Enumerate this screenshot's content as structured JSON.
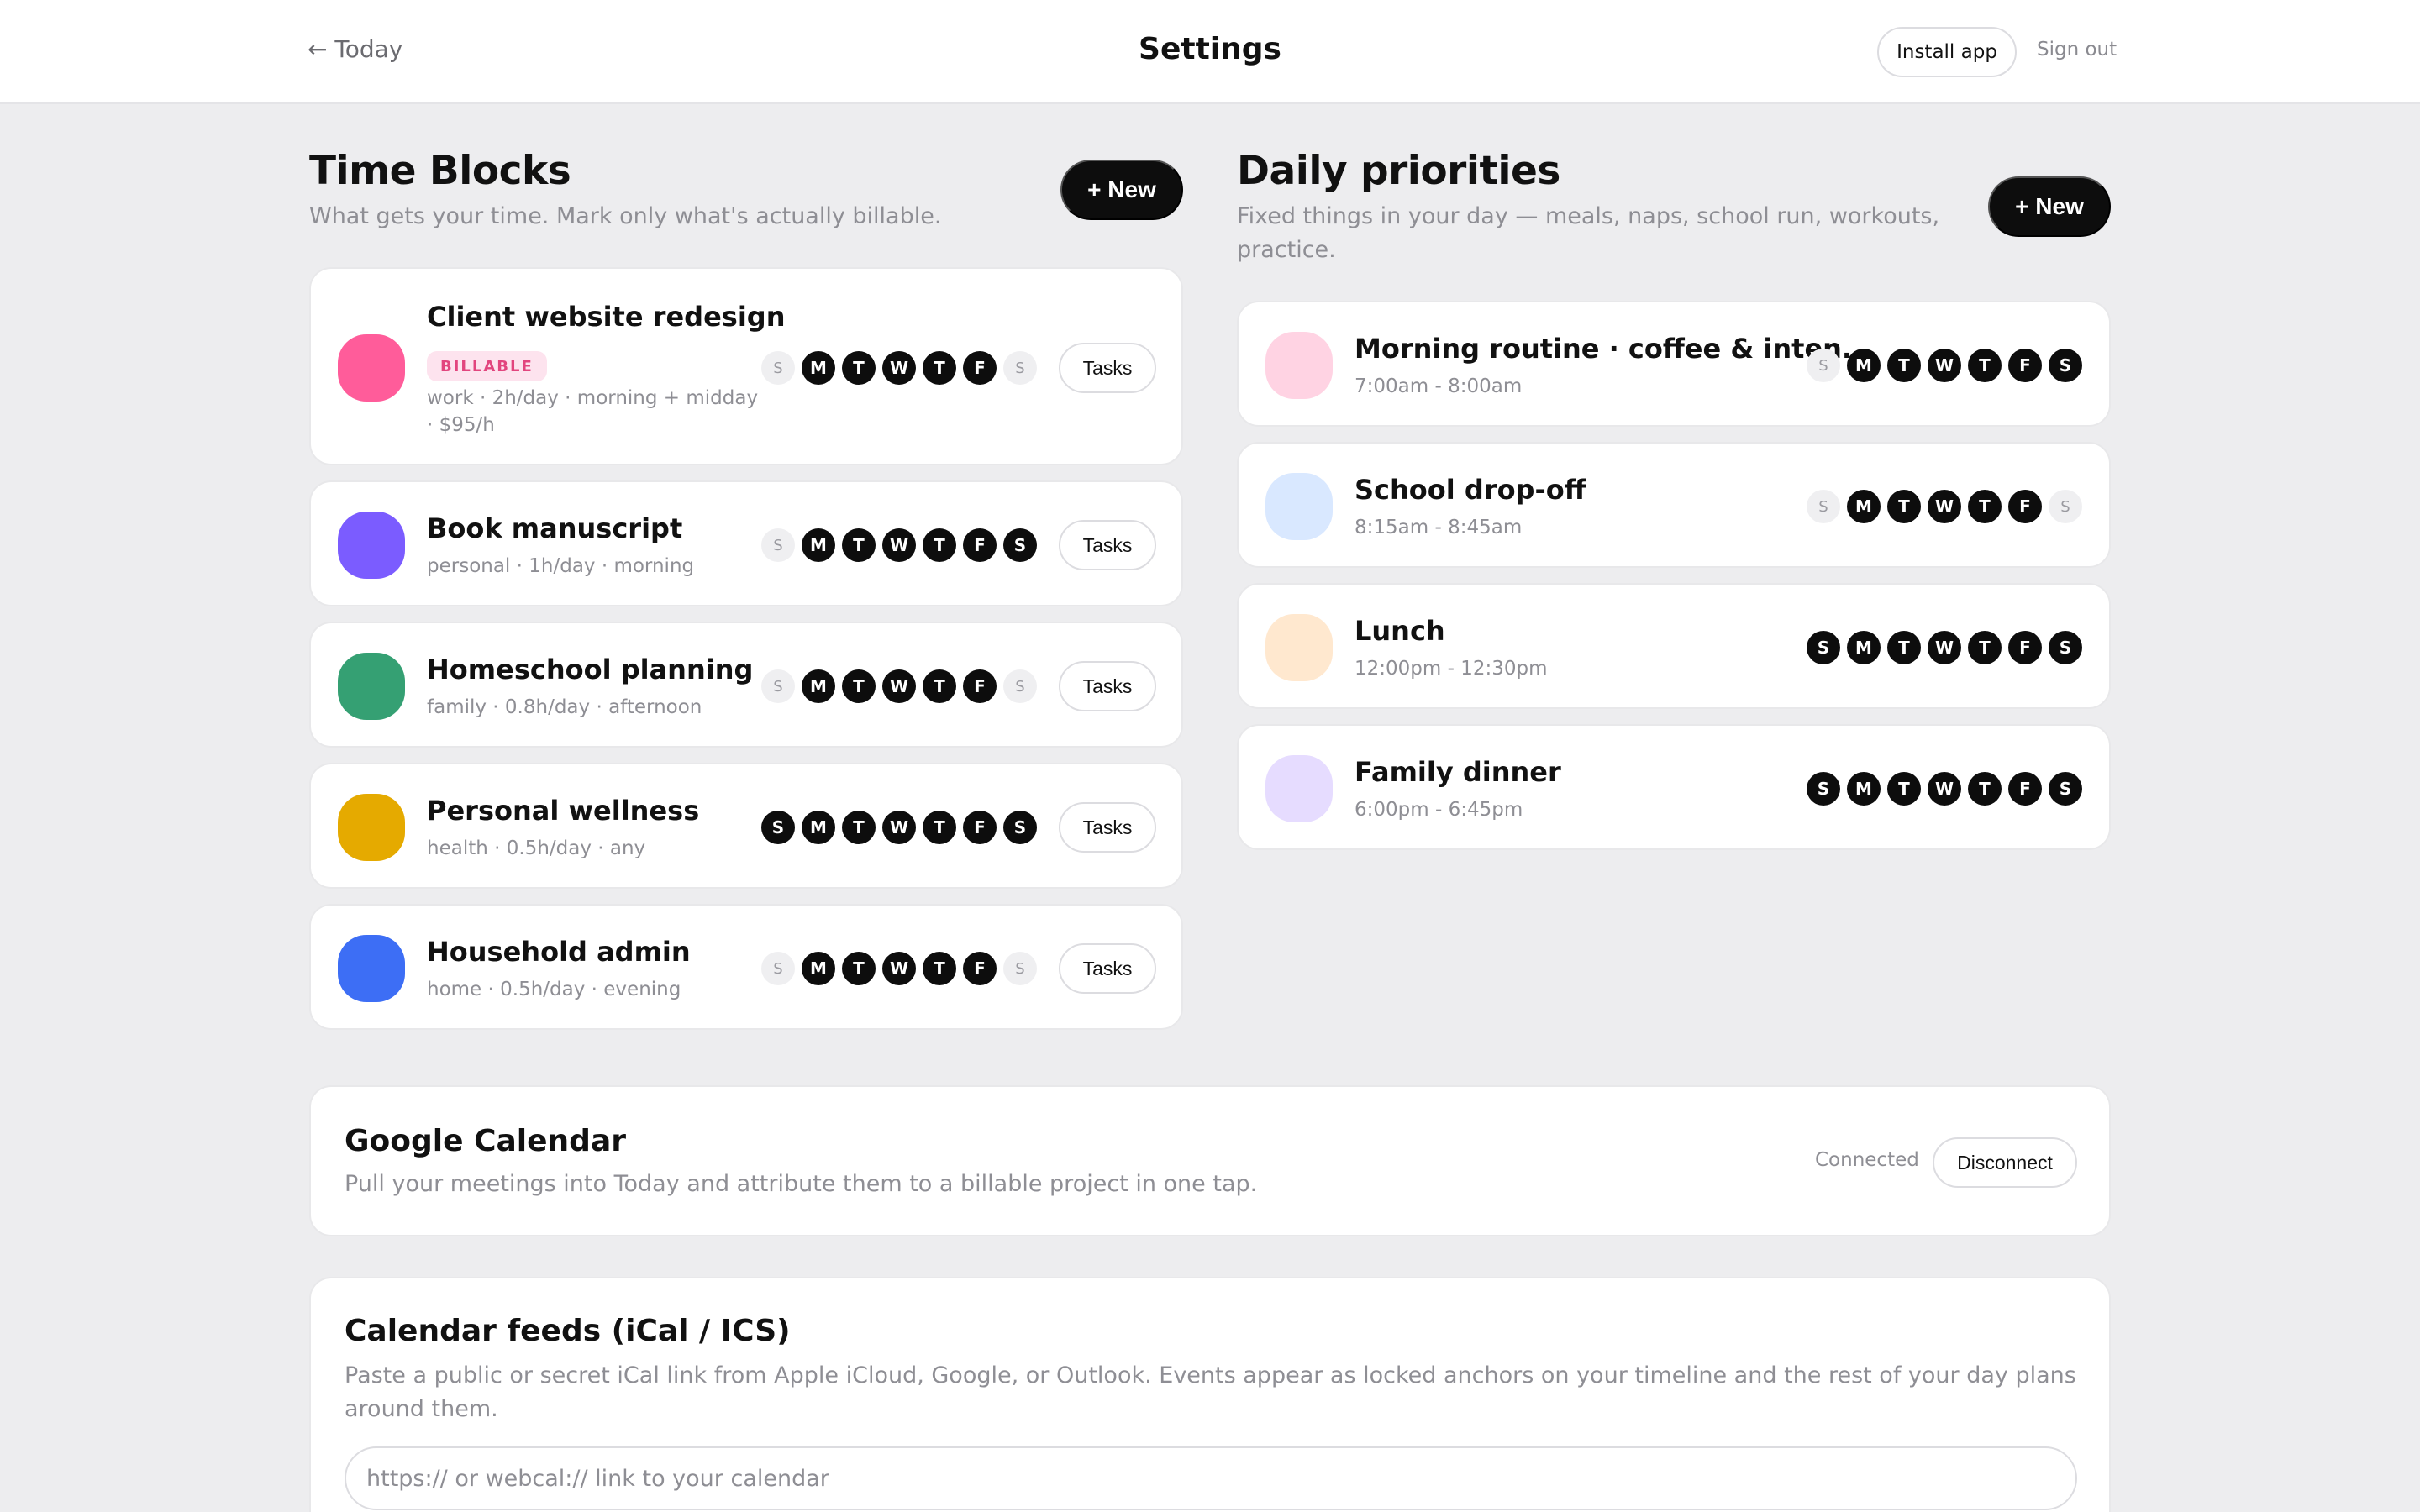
{
  "header": {
    "back_label": "← Today",
    "title": "Settings",
    "install_label": "Install app",
    "signout_label": "Sign out"
  },
  "time_blocks": {
    "title": "Time Blocks",
    "subtitle": "What gets your time. Mark only what's actually billable.",
    "new_label": "+ New",
    "tasks_label": "Tasks",
    "items": [
      {
        "name": "Client website redesign",
        "badge": "BILLABLE",
        "meta_line1": "work · 2h/day · morning + midday",
        "meta_line2": "· $95/h",
        "color": "#ff5c9a",
        "days": [
          "S",
          "M",
          "T",
          "W",
          "T",
          "F",
          "S"
        ],
        "active": [
          false,
          true,
          true,
          true,
          true,
          true,
          false
        ]
      },
      {
        "name": "Book manuscript",
        "meta_line1": "personal · 1h/day · morning",
        "color": "#7b5cff",
        "days": [
          "S",
          "M",
          "T",
          "W",
          "T",
          "F",
          "S"
        ],
        "active": [
          false,
          true,
          true,
          true,
          true,
          true,
          true
        ]
      },
      {
        "name": "Homeschool planning",
        "meta_line1": "family · 0.8h/day · afternoon",
        "color": "#35a073",
        "days": [
          "S",
          "M",
          "T",
          "W",
          "T",
          "F",
          "S"
        ],
        "active": [
          false,
          true,
          true,
          true,
          true,
          true,
          false
        ]
      },
      {
        "name": "Personal wellness",
        "meta_line1": "health · 0.5h/day · any",
        "color": "#e5aa00",
        "days": [
          "S",
          "M",
          "T",
          "W",
          "T",
          "F",
          "S"
        ],
        "active": [
          true,
          true,
          true,
          true,
          true,
          true,
          true
        ]
      },
      {
        "name": "Household admin",
        "meta_line1": "home · 0.5h/day · evening",
        "color": "#3d6ef5",
        "days": [
          "S",
          "M",
          "T",
          "W",
          "T",
          "F",
          "S"
        ],
        "active": [
          false,
          true,
          true,
          true,
          true,
          true,
          false
        ]
      }
    ]
  },
  "daily_priorities": {
    "title": "Daily priorities",
    "subtitle_line1": "Fixed things in your day — meals, naps, school run, workouts,",
    "subtitle_line2": "practice.",
    "new_label": "+ New",
    "items": [
      {
        "name": "Morning routine · coffee & inten...",
        "time": "7:00am - 8:00am",
        "color": "#ffd3e3",
        "days": [
          "S",
          "M",
          "T",
          "W",
          "T",
          "F",
          "S"
        ],
        "active": [
          false,
          true,
          true,
          true,
          true,
          true,
          true
        ]
      },
      {
        "name": "School drop-off",
        "time": "8:15am - 8:45am",
        "color": "#d9e8ff",
        "days": [
          "S",
          "M",
          "T",
          "W",
          "T",
          "F",
          "S"
        ],
        "active": [
          false,
          true,
          true,
          true,
          true,
          true,
          false
        ]
      },
      {
        "name": "Lunch",
        "time": "12:00pm - 12:30pm",
        "color": "#ffe8cf",
        "days": [
          "S",
          "M",
          "T",
          "W",
          "T",
          "F",
          "S"
        ],
        "active": [
          true,
          true,
          true,
          true,
          true,
          true,
          true
        ]
      },
      {
        "name": "Family dinner",
        "time": "6:00pm - 6:45pm",
        "color": "#e6dcff",
        "days": [
          "S",
          "M",
          "T",
          "W",
          "T",
          "F",
          "S"
        ],
        "active": [
          true,
          true,
          true,
          true,
          true,
          true,
          true
        ]
      }
    ]
  },
  "google_calendar": {
    "title": "Google Calendar",
    "subtitle": "Pull your meetings into Today and attribute them to a billable project in one tap.",
    "status": "Connected",
    "disconnect_label": "Disconnect"
  },
  "calendar_feeds": {
    "title": "Calendar feeds (iCal / ICS)",
    "subtitle_line1": "Paste a public or secret iCal link from Apple iCloud, Google, or Outlook. Events appear as locked anchors on your timeline and the rest of your day plans",
    "subtitle_line2": "around them.",
    "input_placeholder": "https:// or webcal:// link to your calendar"
  }
}
